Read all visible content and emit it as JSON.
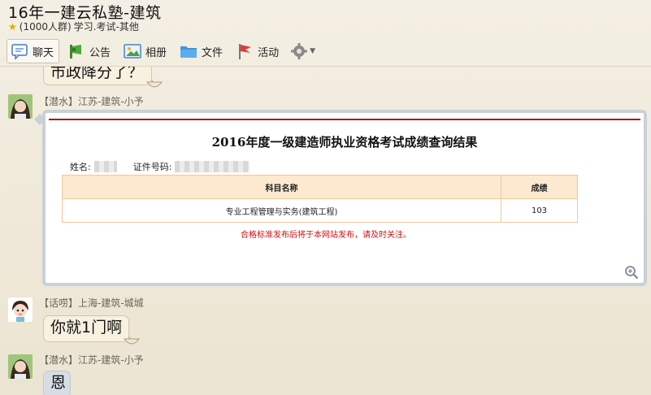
{
  "header": {
    "title": "16年一建云私塾-建筑",
    "members": "(1000人群)",
    "category": "学习.考试-其他"
  },
  "toolbar": {
    "items": [
      {
        "label": "聊天",
        "icon": "chat-icon",
        "active": true
      },
      {
        "label": "公告",
        "icon": "announcement-icon"
      },
      {
        "label": "相册",
        "icon": "album-icon"
      },
      {
        "label": "文件",
        "icon": "folder-icon"
      },
      {
        "label": "活动",
        "icon": "flag-icon"
      }
    ],
    "settings_icon": "gear-icon"
  },
  "messages": [
    {
      "type": "text",
      "text": "市政降分了？",
      "partial": true
    },
    {
      "type": "image",
      "sender": "【潜水】江苏-建筑-小予",
      "image": {
        "title": "2016年度一级建造师执业资格考试成绩查询结果",
        "name_label": "姓名:",
        "id_label": "证件号码:",
        "columns": [
          "科目名称",
          "成绩"
        ],
        "rows": [
          [
            "专业工程管理与实务(建筑工程)",
            "103"
          ]
        ],
        "note": "合格标准发布后将于本网站发布，请及时关注。"
      }
    },
    {
      "type": "text",
      "sender": "【话唠】上海-建筑-城城",
      "text": "你就1门啊"
    },
    {
      "type": "text",
      "sender": "【潜水】江苏-建筑-小予",
      "text": "恩"
    }
  ],
  "colors": {
    "accent_red": "#b01010",
    "table_header": "#fde9cf",
    "bubble": "#f8f1e0"
  }
}
